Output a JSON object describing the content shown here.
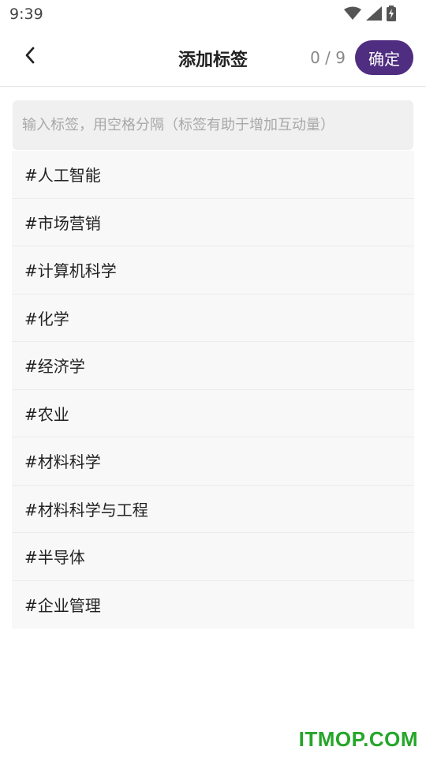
{
  "status_bar": {
    "time": "9:39",
    "icons": [
      "wifi-icon",
      "cellular-signal-icon",
      "battery-charging-icon"
    ]
  },
  "header": {
    "title": "添加标签",
    "counter": "0 / 9",
    "confirm_label": "确定",
    "back_icon": "chevron-left-icon"
  },
  "tag_input": {
    "value": "",
    "placeholder": "输入标签，用空格分隔（标签有助于增加互动量）"
  },
  "suggestions": [
    "#人工智能",
    "#市场营销",
    "#计算机科学",
    "#化学",
    "#经济学",
    "#农业",
    "#材料科学",
    "#材料科学与工程",
    "#半导体",
    "#企业管理"
  ],
  "watermark": "ITMOP.COM",
  "colors": {
    "accent": "#4f2d80",
    "watermark": "#25a62a",
    "list_bg": "#f8f8f8",
    "input_bg": "#f0f0f0"
  }
}
